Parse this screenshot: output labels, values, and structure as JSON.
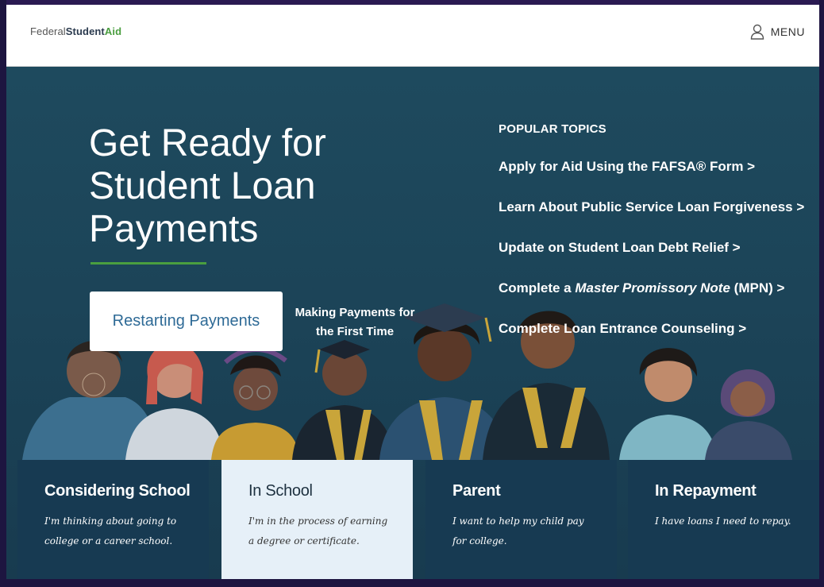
{
  "header": {
    "logo": {
      "word1": "Federal",
      "word2": "Student",
      "word3": "Aid"
    },
    "menu_label": "MENU",
    "menu_icon": "user-icon"
  },
  "hero": {
    "title": "Get Ready for Student Loan Payments",
    "primary_button": "Restarting Payments",
    "secondary_link": "Making Payments for the First Time"
  },
  "popular_topics": {
    "heading": "POPULAR TOPICS",
    "items": [
      {
        "label": "Apply for Aid Using the FAFSA® Form >"
      },
      {
        "label": "Learn About Public Service Loan Forgiveness >"
      },
      {
        "label": "Update on Student Loan Debt Relief >"
      },
      {
        "label_before": "Complete a ",
        "label_italic": "Master Promissory Note",
        "label_after": " (MPN) >"
      },
      {
        "label": "Complete Loan Entrance Counseling >"
      }
    ]
  },
  "cards": [
    {
      "title": "Considering School",
      "desc": "I'm thinking about going to college or a career school."
    },
    {
      "title": "In School",
      "desc": "I'm in the process of earning a degree or certificate."
    },
    {
      "title": "Parent",
      "desc": "I want to help my child pay for college."
    },
    {
      "title": "In Repayment",
      "desc": "I have loans I need to repay."
    }
  ],
  "colors": {
    "hero_bg": "#1e4a5e",
    "accent_green": "#4a9e3f",
    "link_blue": "#2e6a96",
    "card_bg": "#173a52",
    "card_active_bg": "#e6f0f8"
  }
}
